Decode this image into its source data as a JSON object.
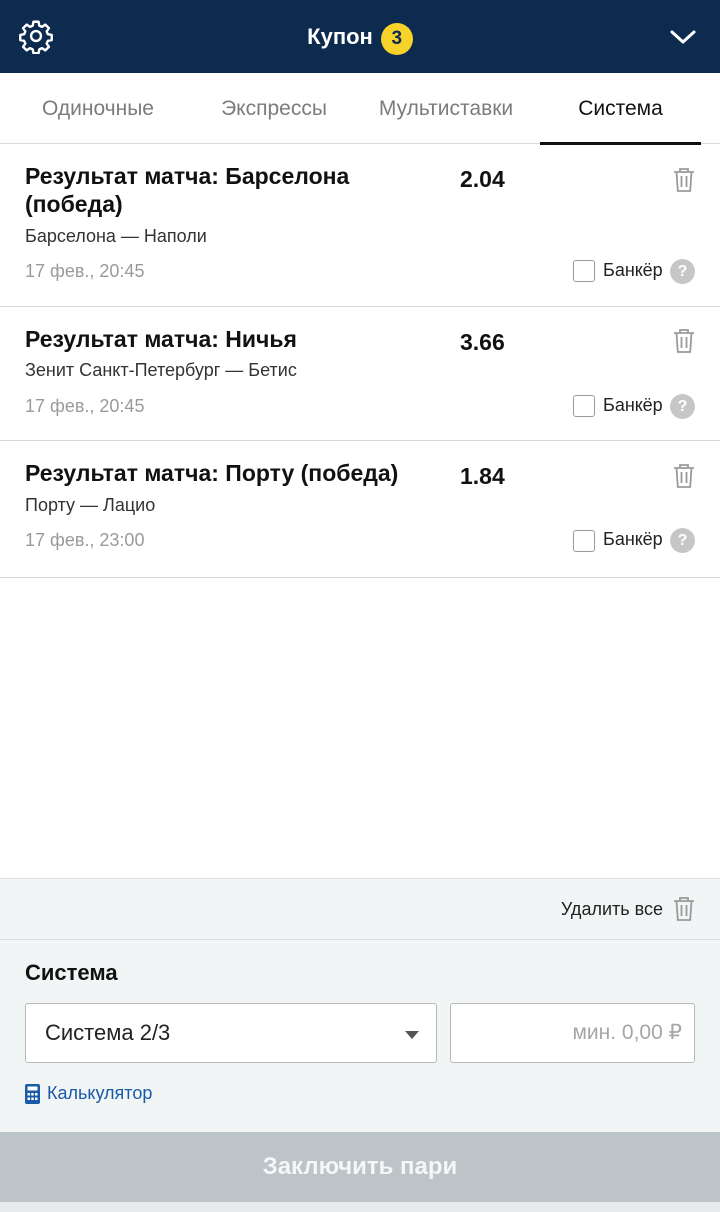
{
  "header": {
    "title": "Купон",
    "badge_count": "3",
    "settings_icon": "gear-icon",
    "collapse_icon": "chevron-down-icon",
    "colors": {
      "bar": "#0d2a4f",
      "badge": "#f6d22a"
    }
  },
  "tabs": [
    {
      "label": "Одиночные",
      "active": false
    },
    {
      "label": "Экспрессы",
      "active": false
    },
    {
      "label": "Мультиставки",
      "active": false
    },
    {
      "label": "Система",
      "active": true
    }
  ],
  "bets": [
    {
      "name": "Результат матча: Барселона (победа)",
      "odds": "2.04",
      "teams": "Барселона — Наполи",
      "time": "17 фев., 20:45",
      "banker_label": "Банкёр",
      "banker_checked": false
    },
    {
      "name": "Результат матча: Ничья",
      "odds": "3.66",
      "teams": "Зенит Санкт-Петербург — Бетис",
      "time": "17 фев., 20:45",
      "banker_label": "Банкёр",
      "banker_checked": false
    },
    {
      "name": "Результат матча: Порту (победа)",
      "odds": "1.84",
      "teams": "Порту — Лацио",
      "time": "17 фев., 23:00",
      "banker_label": "Банкёр",
      "banker_checked": false
    }
  ],
  "help_glyph": "?",
  "delete_all_label": "Удалить все",
  "system": {
    "heading": "Система",
    "selected": "Система 2/3",
    "amount_placeholder": "мин. 0,00 ₽",
    "calculator_label": "Калькулятор"
  },
  "submit_label": "Заключить пари",
  "colors": {
    "link": "#1a5aa6",
    "submit_disabled": "#bcc4c8"
  }
}
